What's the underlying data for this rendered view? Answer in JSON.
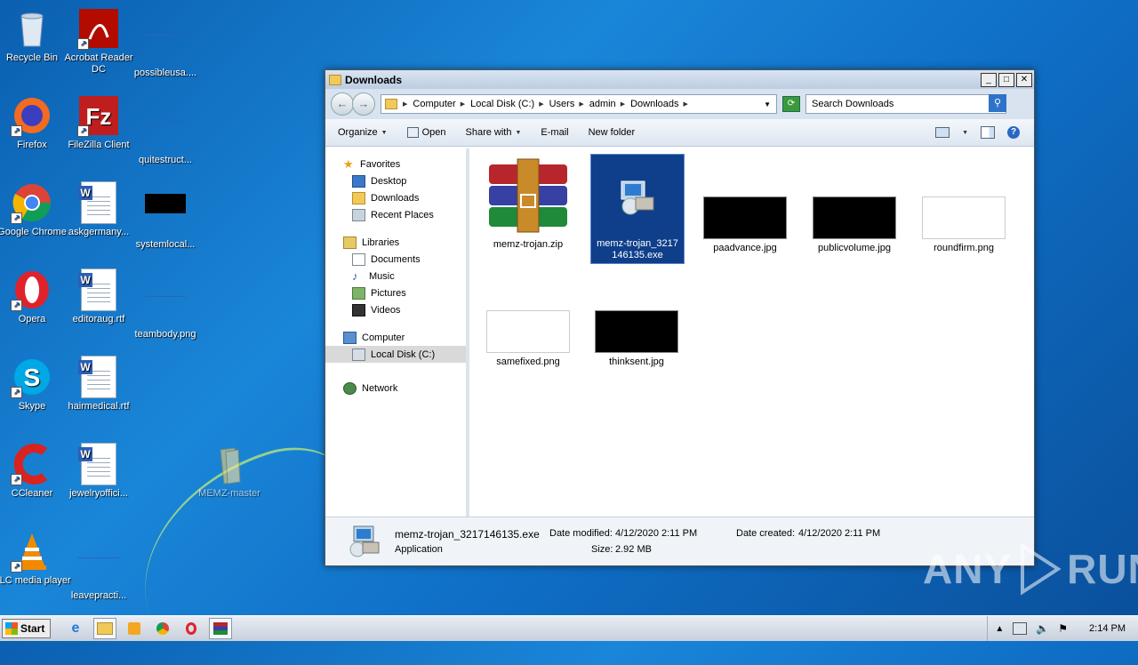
{
  "desktop": {
    "icons": [
      {
        "label": "Recycle Bin"
      },
      {
        "label": "Acrobat Reader DC"
      },
      {
        "label": "possibleusa...."
      },
      {
        "label": "Firefox"
      },
      {
        "label": "FileZilla Client"
      },
      {
        "label": "quitestruct..."
      },
      {
        "label": "Google Chrome"
      },
      {
        "label": "askgermany..."
      },
      {
        "label": "systemlocal..."
      },
      {
        "label": "Opera"
      },
      {
        "label": "editoraug.rtf"
      },
      {
        "label": "teambody.png"
      },
      {
        "label": "Skype"
      },
      {
        "label": "hairmedical.rtf"
      },
      {
        "label": "CCleaner"
      },
      {
        "label": "jewelryoffici..."
      },
      {
        "label": "MEMZ-master"
      },
      {
        "label": "VLC media player"
      },
      {
        "label": "leavepracti..."
      }
    ]
  },
  "window": {
    "title": "Downloads",
    "breadcrumb": [
      "Computer",
      "Local Disk (C:)",
      "Users",
      "admin",
      "Downloads"
    ],
    "search_placeholder": "Search Downloads",
    "toolbar": {
      "organize": "Organize",
      "open": "Open",
      "share_with": "Share with",
      "email": "E-mail",
      "new_folder": "New folder"
    },
    "nav": {
      "favorites": "Favorites",
      "desktop": "Desktop",
      "downloads": "Downloads",
      "recent": "Recent Places",
      "libraries": "Libraries",
      "documents": "Documents",
      "music": "Music",
      "pictures": "Pictures",
      "videos": "Videos",
      "computer": "Computer",
      "local_disk": "Local Disk (C:)",
      "network": "Network"
    },
    "files": [
      {
        "name": "memz-trojan.zip"
      },
      {
        "name": "memz-trojan_3217146135.exe"
      },
      {
        "name": "paadvance.jpg"
      },
      {
        "name": "publicvolume.jpg"
      },
      {
        "name": "roundfirm.png"
      },
      {
        "name": "samefixed.png"
      },
      {
        "name": "thinksent.jpg"
      }
    ],
    "details": {
      "name": "memz-trojan_3217146135.exe",
      "type": "Application",
      "date_modified_label": "Date modified:",
      "date_modified": "4/12/2020 2:11 PM",
      "date_created_label": "Date created:",
      "date_created": "4/12/2020 2:11 PM",
      "size_label": "Size:",
      "size": "2.92 MB"
    }
  },
  "taskbar": {
    "start": "Start",
    "clock": "2:14 PM"
  },
  "watermark": {
    "left": "ANY",
    "right": "RUN"
  }
}
